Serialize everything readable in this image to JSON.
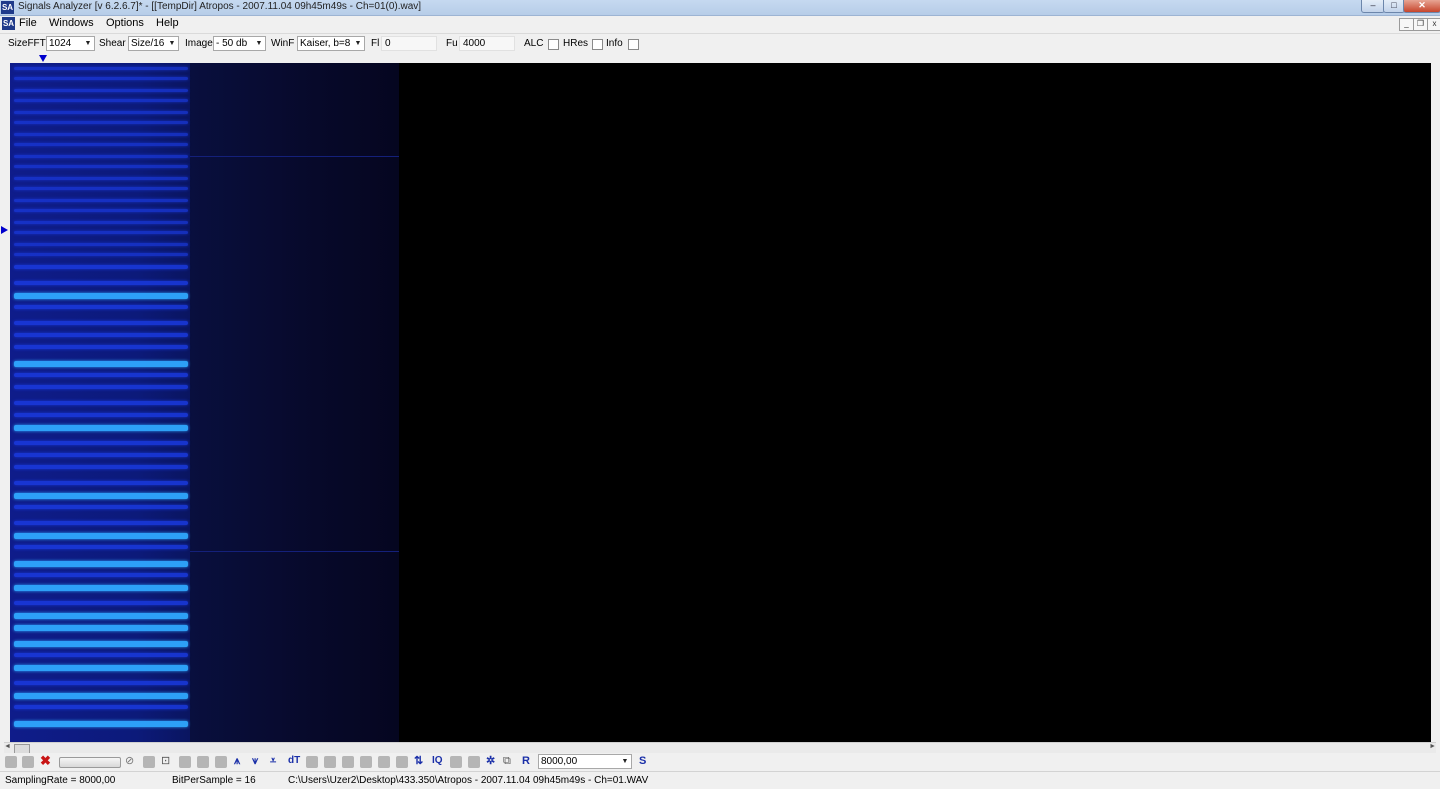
{
  "window": {
    "app_icon": "SA",
    "title": "Signals Analyzer [v 6.2.6.7]* - [[TempDir] Atropos - 2007.11.04 09h45m49s - Ch=01(0).wav]",
    "minimize_glyph": "–",
    "maximize_glyph": "□",
    "close_glyph": "✕"
  },
  "menu": {
    "items": [
      "File",
      "Windows",
      "Options",
      "Help"
    ],
    "mdi_minimize": "_",
    "mdi_restore": "❐",
    "mdi_close": "x"
  },
  "toolbar": {
    "sizefft_label": "SizeFFT",
    "sizefft_value": "1024",
    "shear_label": "Shear",
    "shear_value": "Size/16",
    "image_label": "Image",
    "image_value": "- 50 db",
    "winf_label": "WinF",
    "winf_value": "Kaiser, b=8",
    "fl_label": "Fl",
    "fl_value": "0",
    "fu_label": "Fu",
    "fu_value": "4000",
    "alc_label": "ALC",
    "alc_checked": false,
    "hres_label": "HRes",
    "hres_checked": false,
    "info_label": "Info",
    "info_checked": false
  },
  "bottom_toolbar": {
    "icons": [
      "delete-icon",
      "no-entry-icon",
      "frame-icon",
      "align-top-icon",
      "align-middle-icon",
      "align-bottom-icon",
      "dt-icon",
      "freq-swap-icon",
      "iq-icon",
      "settings-icon",
      "copy-icon",
      "r-icon",
      "s-icon"
    ],
    "dt_label": "dT",
    "iq_label": "IQ",
    "r_label": "R",
    "s_label": "S",
    "rate_value": "8000,00"
  },
  "statusbar": {
    "sampling_rate": "SamplingRate = 8000,00",
    "bits_per_sample": "BitPerSample = 16",
    "file_path": "C:\\Users\\Uzer2\\Desktop\\433.350\\Atropos - 2007.11.04 09h45m49s - Ch=01.WAV"
  },
  "colors": {
    "spectrogram_background": "#000000",
    "signal_dim": "#1a3ae0",
    "signal_bright": "#2fa8ff",
    "marker": "#0000cc"
  }
}
